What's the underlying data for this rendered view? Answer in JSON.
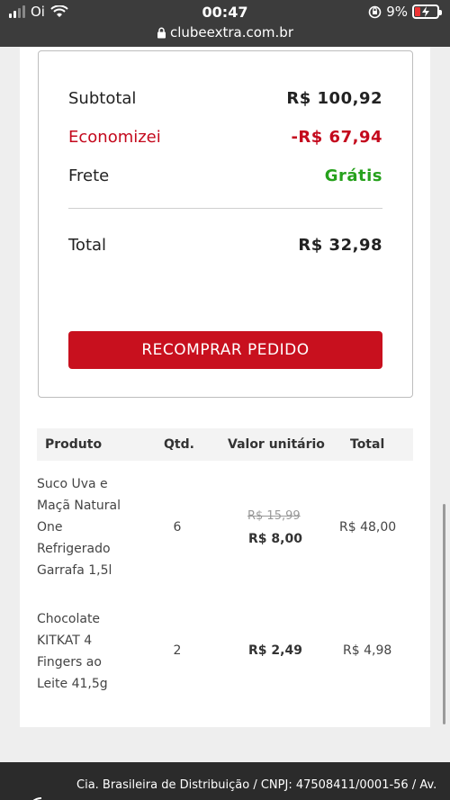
{
  "status_bar": {
    "carrier": "Oi",
    "time": "00:47",
    "battery": "9%",
    "url": "clubeextra.com.br"
  },
  "summary": {
    "subtotal_label": "Subtotal",
    "subtotal_value": "R$ 100,92",
    "economizei_label": "Economizei",
    "economizei_value": "-R$ 67,94",
    "frete_label": "Frete",
    "frete_value": "Grátis",
    "total_label": "Total",
    "total_value": "R$ 32,98",
    "button_label": "RECOMPRAR PEDIDO"
  },
  "table": {
    "headers": [
      "Produto",
      "Qtd.",
      "Valor unitário",
      "Total"
    ],
    "rows": [
      {
        "product_lines": [
          "Suco Uva e",
          "Maçã Natural",
          "One",
          "Refrigerado",
          "Garrafa 1,5l"
        ],
        "qty": "6",
        "old_price": "R$ 15,99",
        "unit_price": "R$ 8,00",
        "total": "R$ 48,00"
      },
      {
        "product_lines": [
          "Chocolate",
          "KITKAT 4",
          "Fingers ao",
          "Leite 41,5g"
        ],
        "qty": "2",
        "old_price": "",
        "unit_price": "R$ 2,49",
        "total": "R$ 4,98"
      }
    ]
  },
  "footer": {
    "text": "Cia. Brasileira de Distribuição / CNPJ: 47508411/0001-56 / Av."
  },
  "colors": {
    "accent_red": "#c8101e",
    "savings_red": "#c4091d",
    "free_green": "#26a11c"
  }
}
